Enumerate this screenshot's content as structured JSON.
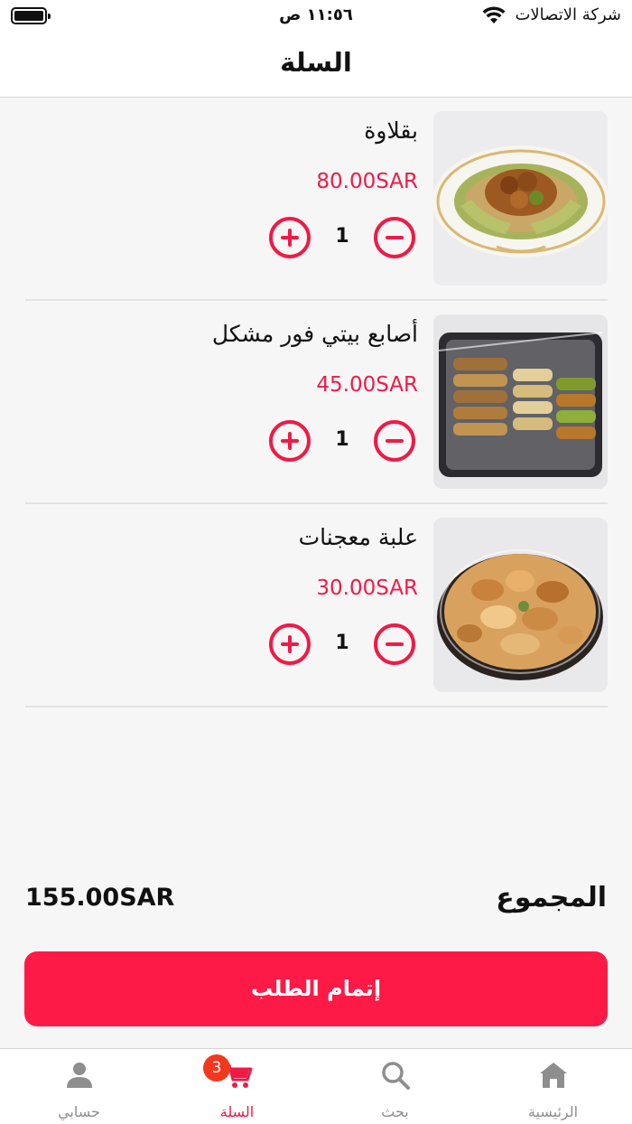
{
  "status_bar": {
    "time": "١١:٥٦ ص",
    "carrier": "شركة الاتصالات"
  },
  "header": {
    "title": "السلة"
  },
  "cart": {
    "items": [
      {
        "name": "بقلاوة",
        "price": "80.00SAR",
        "quantity": "1"
      },
      {
        "name": "أصابع بيتي فور مشكل",
        "price": "45.00SAR",
        "quantity": "1"
      },
      {
        "name": "علبة معجنات",
        "price": "30.00SAR",
        "quantity": "1"
      }
    ]
  },
  "summary": {
    "total_label": "المجموع",
    "total_value": "155.00SAR"
  },
  "checkout": {
    "label": "إتمام الطلب"
  },
  "tabbar": {
    "home": "الرئيسية",
    "search": "بحث",
    "cart": "السلة",
    "cart_badge": "3",
    "account": "حسابي"
  },
  "colors": {
    "accent": "#fe1a47",
    "price": "#ee1b47",
    "badge": "#f2381f",
    "inactive_tab": "#8e8e8e"
  },
  "icons": [
    "battery-icon",
    "wifi-icon",
    "plus-icon",
    "minus-icon",
    "home-icon",
    "search-icon",
    "cart-icon",
    "user-icon"
  ]
}
